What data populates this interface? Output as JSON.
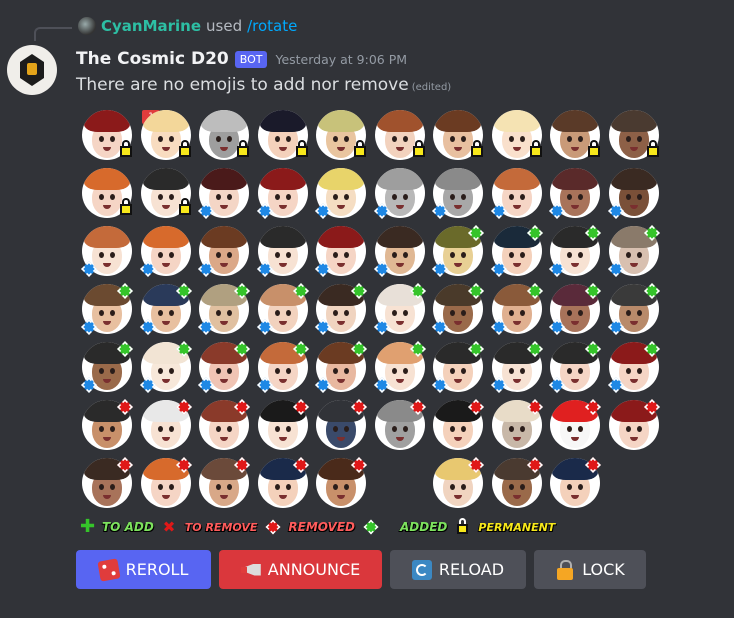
{
  "reply": {
    "username": "CyanMarine",
    "used_text": "used",
    "command": "/rotate"
  },
  "message": {
    "bot_name": "The Cosmic D20",
    "badge": "BOT",
    "timestamp": "Yesterday at 9:06 PM",
    "content": "There are no emojis to add nor remove",
    "edited": "(edited)"
  },
  "emojis": {
    "notification_count": "1",
    "rows": [
      [
        {
          "hair": "#8b1a1a",
          "skin": "#f5d5c5",
          "mark": "lock"
        },
        {
          "hair": "#f3d79a",
          "skin": "#f8dcc0",
          "mark": "lock"
        },
        {
          "hair": "#bdbdbd",
          "skin": "#9e9e9e",
          "mark": "lock"
        },
        {
          "hair": "#1a1a2a",
          "skin": "#f4d1bb",
          "mark": "lock"
        },
        {
          "hair": "#c8c27a",
          "skin": "#e9c59f",
          "mark": "lock"
        },
        {
          "hair": "#a0522d",
          "skin": "#f2d2be",
          "mark": "lock"
        },
        {
          "hair": "#6b3b22",
          "skin": "#e8c0a0",
          "mark": "lock"
        },
        {
          "hair": "#f5e3b3",
          "skin": "#f9e0cc",
          "mark": "lock"
        },
        {
          "hair": "#5a3a28",
          "skin": "#c99a78",
          "mark": "lock"
        },
        {
          "hair": "#4a3a30",
          "skin": "#8d6047",
          "mark": "lock"
        }
      ],
      [
        {
          "hair": "#d76a2c",
          "skin": "#f5d5c5",
          "mark": "lock"
        },
        {
          "hair": "#2a2a2a",
          "skin": "#f7e2d3",
          "mark": "lock"
        },
        {
          "hair": "#4a1a1a",
          "skin": "#f4d6c6",
          "mark": "blue"
        },
        {
          "hair": "#8b1a1a",
          "skin": "#f5d5c5",
          "mark": "blue"
        },
        {
          "hair": "#e8d46a",
          "skin": "#f5ddc2",
          "mark": "blue"
        },
        {
          "hair": "#9e9e9e",
          "skin": "#b8b8b8",
          "mark": "blue"
        },
        {
          "hair": "#8a8a8a",
          "skin": "#a8a8a8",
          "mark": "blue"
        },
        {
          "hair": "#c46a3a",
          "skin": "#f5d5c5",
          "mark": "blue"
        },
        {
          "hair": "#5a2a2a",
          "skin": "#a8735a",
          "mark": "blue"
        },
        {
          "hair": "#3a2a22",
          "skin": "#7a5038",
          "mark": "blue"
        }
      ],
      [
        {
          "hair": "#c46a3a",
          "skin": "#f7e2d3",
          "mark": "blue"
        },
        {
          "hair": "#d76a2c",
          "skin": "#f5d5c5",
          "mark": "blue"
        },
        {
          "hair": "#6b3b22",
          "skin": "#dba888",
          "mark": "blue"
        },
        {
          "hair": "#2a2a2a",
          "skin": "#f7e2d3",
          "mark": "blue"
        },
        {
          "hair": "#8b1a1a",
          "skin": "#f5d5c5",
          "mark": "blue"
        },
        {
          "hair": "#3a2a22",
          "skin": "#e0b894",
          "mark": "blue"
        },
        {
          "hair": "#6a6a2a",
          "skin": "#e8d094",
          "mark": "bluegreen"
        },
        {
          "hair": "#1a2a3a",
          "skin": "#f4d1bb",
          "mark": "bluegreen"
        },
        {
          "hair": "#2a2a2a",
          "skin": "#f7e2d3",
          "mark": "bluegreen"
        },
        {
          "hair": "#8a7a6a",
          "skin": "#d8c0b0",
          "mark": "bluegreen"
        }
      ],
      [
        {
          "hair": "#6b4a30",
          "skin": "#e8c0a0",
          "mark": "bluegreen"
        },
        {
          "hair": "#2a3a5a",
          "skin": "#e8c0a0",
          "mark": "bluegreen"
        },
        {
          "hair": "#b0a080",
          "skin": "#e0c0a0",
          "mark": "bluegreen"
        },
        {
          "hair": "#c8906a",
          "skin": "#f2d2be",
          "mark": "bluegreen"
        },
        {
          "hair": "#3a2a22",
          "skin": "#f0d4c0",
          "mark": "bluegreen"
        },
        {
          "hair": "#e8e0d8",
          "skin": "#f7e2d3",
          "mark": "bluegreen"
        },
        {
          "hair": "#4a3a2a",
          "skin": "#9a6a4a",
          "mark": "bluegreen"
        },
        {
          "hair": "#8a5a3a",
          "skin": "#e0b090",
          "mark": "bluegreen"
        },
        {
          "hair": "#5a2a3a",
          "skin": "#a8735a",
          "mark": "bluegreen"
        },
        {
          "hair": "#3a3a3a",
          "skin": "#b88a6a",
          "mark": "bluegreen"
        }
      ],
      [
        {
          "hair": "#2a2a2a",
          "skin": "#9a6a4a",
          "mark": "bluegreen"
        },
        {
          "hair": "#f2e4d4",
          "skin": "#f7e8da",
          "mark": "bluegreen"
        },
        {
          "hair": "#8a3a2a",
          "skin": "#f0c4b4",
          "mark": "bluegreen"
        },
        {
          "hair": "#c46a3a",
          "skin": "#f5d5c5",
          "mark": "bluegreen"
        },
        {
          "hair": "#6b3b22",
          "skin": "#e8b8a0",
          "mark": "bluegreen"
        },
        {
          "hair": "#e0a070",
          "skin": "#f7e2d3",
          "mark": "bluegreen"
        },
        {
          "hair": "#2a2a2a",
          "skin": "#f4d1bb",
          "mark": "bluegreen"
        },
        {
          "hair": "#2a2a2a",
          "skin": "#f7e2d3",
          "mark": "bluegreen"
        },
        {
          "hair": "#2a2a2a",
          "skin": "#f5d5c5",
          "mark": "bluegreen"
        },
        {
          "hair": "#8b1a1a",
          "skin": "#f5d5c5",
          "mark": "bluegreen"
        }
      ],
      [
        {
          "hair": "#2a2a2a",
          "skin": "#c8906a",
          "mark": "red"
        },
        {
          "hair": "#e8e8e8",
          "skin": "#f7e2d3",
          "mark": "red"
        },
        {
          "hair": "#8a3a2a",
          "skin": "#f5d5c5",
          "mark": "red"
        },
        {
          "hair": "#1a1a1a",
          "skin": "#f7e2d3",
          "mark": "red"
        },
        {
          "hair": "#313338",
          "skin": "#3a4a6a",
          "mark": "red"
        },
        {
          "hair": "#8a8a8a",
          "skin": "#a0a0a0",
          "mark": "red"
        },
        {
          "hair": "#1a1a1a",
          "skin": "#f4d1bb",
          "mark": "red"
        },
        {
          "hair": "#e8dcc8",
          "skin": "#c8b8a8",
          "mark": "red"
        },
        {
          "hair": "#e02020",
          "skin": "#f7f7f7",
          "mark": "red"
        },
        {
          "hair": "#8b1a1a",
          "skin": "#f5d5c5",
          "mark": "red"
        }
      ],
      [
        {
          "hair": "#3a2a22",
          "skin": "#a8735a",
          "mark": "red"
        },
        {
          "hair": "#d76a2c",
          "skin": "#f5d5c5",
          "mark": "red"
        },
        {
          "hair": "#6b4a3a",
          "skin": "#d8a888",
          "mark": "red"
        },
        {
          "hair": "#1a2a4a",
          "skin": "#f4d1bb",
          "mark": "red"
        },
        {
          "hair": "#4a2a1a",
          "skin": "#c8906a",
          "mark": "red"
        },
        null,
        {
          "hair": "#e8c870",
          "skin": "#f0d4c0",
          "mark": "red"
        },
        {
          "hair": "#4a3a30",
          "skin": "#9a6a4a",
          "mark": "red"
        },
        {
          "hair": "#1a2a4a",
          "skin": "#f4d1bb",
          "mark": "red"
        }
      ]
    ]
  },
  "legend": {
    "to_add": "TO ADD",
    "to_remove": "TO REMOVE",
    "removed": "REMOVED",
    "added": "ADDED",
    "permanent": "PERMANENT"
  },
  "buttons": {
    "reroll": "REROLL",
    "announce": "ANNOUNCE",
    "reload": "RELOAD",
    "lock": "LOCK"
  },
  "colors": {
    "background": "#313338",
    "bot_badge": "#5865f2",
    "reroll_button": "#5865f2",
    "announce_button": "#da373c",
    "secondary_button": "#4e5058",
    "username": "#2dbfa4",
    "command_link": "#00a8fc"
  }
}
